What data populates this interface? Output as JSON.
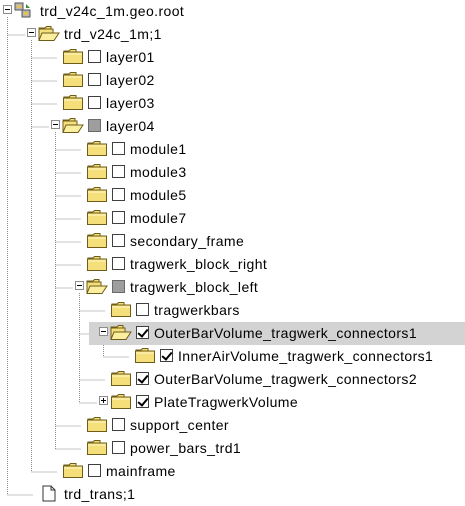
{
  "tree": {
    "nodes": [
      {
        "label": "trd_v24c_1m.geo.root",
        "depth": 0,
        "icon": "root-icon",
        "expander": "minus",
        "checkbox": "none",
        "selected": false
      },
      {
        "label": "trd_v24c_1m;1",
        "depth": 1,
        "icon": "folder-open-icon",
        "expander": "minus",
        "checkbox": "none",
        "selected": false
      },
      {
        "label": "layer01",
        "depth": 2,
        "icon": "folder-icon",
        "expander": "none",
        "checkbox": "unchecked",
        "selected": false
      },
      {
        "label": "layer02",
        "depth": 2,
        "icon": "folder-icon",
        "expander": "none",
        "checkbox": "unchecked",
        "selected": false
      },
      {
        "label": "layer03",
        "depth": 2,
        "icon": "folder-icon",
        "expander": "none",
        "checkbox": "unchecked",
        "selected": false
      },
      {
        "label": "layer04",
        "depth": 2,
        "icon": "folder-open-icon",
        "expander": "minus",
        "checkbox": "partial",
        "selected": false
      },
      {
        "label": "module1",
        "depth": 3,
        "icon": "folder-icon",
        "expander": "none",
        "checkbox": "unchecked",
        "selected": false
      },
      {
        "label": "module3",
        "depth": 3,
        "icon": "folder-icon",
        "expander": "none",
        "checkbox": "unchecked",
        "selected": false
      },
      {
        "label": "module5",
        "depth": 3,
        "icon": "folder-icon",
        "expander": "none",
        "checkbox": "unchecked",
        "selected": false
      },
      {
        "label": "module7",
        "depth": 3,
        "icon": "folder-icon",
        "expander": "none",
        "checkbox": "unchecked",
        "selected": false
      },
      {
        "label": "secondary_frame",
        "depth": 3,
        "icon": "folder-icon",
        "expander": "none",
        "checkbox": "unchecked",
        "selected": false
      },
      {
        "label": "tragwerk_block_right",
        "depth": 3,
        "icon": "folder-icon",
        "expander": "none",
        "checkbox": "unchecked",
        "selected": false
      },
      {
        "label": "tragwerk_block_left",
        "depth": 3,
        "icon": "folder-open-icon",
        "expander": "minus",
        "checkbox": "partial",
        "selected": false
      },
      {
        "label": "tragwerkbars",
        "depth": 4,
        "icon": "folder-icon",
        "expander": "none",
        "checkbox": "unchecked",
        "selected": false
      },
      {
        "label": "OuterBarVolume_tragwerk_connectors1",
        "depth": 4,
        "icon": "folder-open-icon",
        "expander": "minus",
        "checkbox": "checked",
        "selected": true
      },
      {
        "label": "InnerAirVolume_tragwerk_connectors1",
        "depth": 5,
        "icon": "folder-icon",
        "expander": "none",
        "checkbox": "checked",
        "selected": false
      },
      {
        "label": "OuterBarVolume_tragwerk_connectors2",
        "depth": 4,
        "icon": "folder-icon",
        "expander": "none",
        "checkbox": "checked",
        "selected": false
      },
      {
        "label": "PlateTragwerkVolume",
        "depth": 4,
        "icon": "folder-icon",
        "expander": "plus",
        "checkbox": "checked",
        "selected": false
      },
      {
        "label": "support_center",
        "depth": 3,
        "icon": "folder-icon",
        "expander": "none",
        "checkbox": "unchecked",
        "selected": false
      },
      {
        "label": "power_bars_trd1",
        "depth": 3,
        "icon": "folder-icon",
        "expander": "none",
        "checkbox": "unchecked",
        "selected": false
      },
      {
        "label": "mainframe",
        "depth": 2,
        "icon": "folder-icon",
        "expander": "none",
        "checkbox": "unchecked",
        "selected": false
      },
      {
        "label": "trd_trans;1",
        "depth": 1,
        "icon": "document-icon",
        "expander": "none",
        "checkbox": "none",
        "selected": false
      }
    ]
  },
  "colors": {
    "folder_fill": "#f4df7a",
    "folder_stroke": "#6e5c1a",
    "selection": "#d3d3d3",
    "tree_lines": "#8c8c8c"
  }
}
